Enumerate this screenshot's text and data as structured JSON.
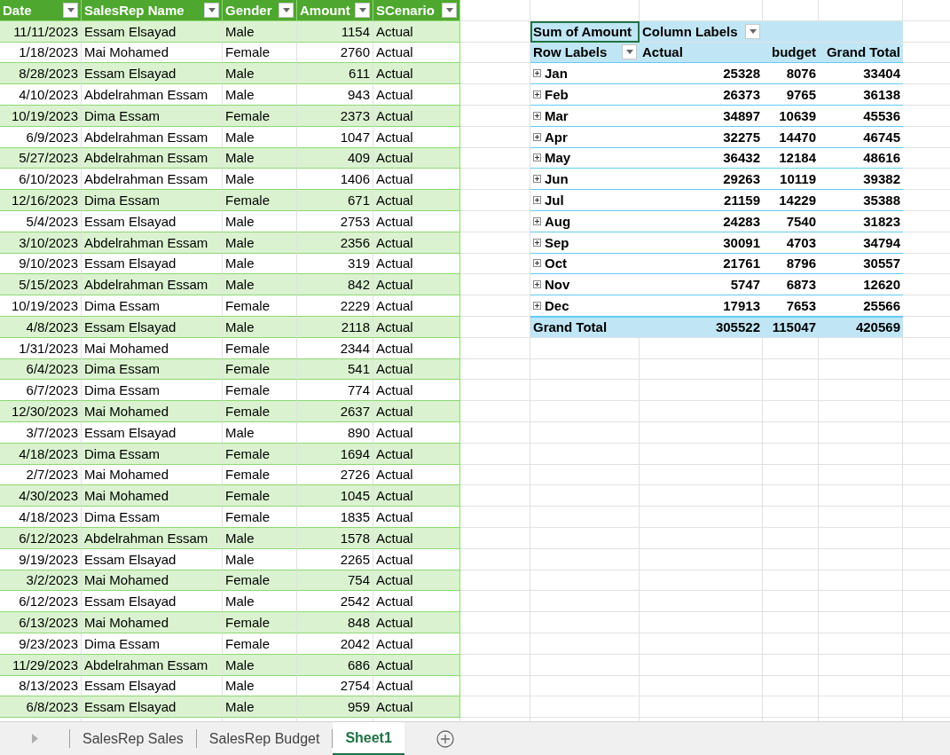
{
  "table": {
    "columns": [
      "Date",
      "SalesRep Name",
      "Gender",
      "Amount",
      "SCenario"
    ],
    "rows": [
      [
        "11/11/2023",
        "Essam Elsayad",
        "Male",
        "1154",
        "Actual"
      ],
      [
        "1/18/2023",
        "Mai Mohamed",
        "Female",
        "2760",
        "Actual"
      ],
      [
        "8/28/2023",
        "Essam Elsayad",
        "Male",
        "611",
        "Actual"
      ],
      [
        "4/10/2023",
        "Abdelrahman Essam",
        "Male",
        "943",
        "Actual"
      ],
      [
        "10/19/2023",
        "Dima Essam",
        "Female",
        "2373",
        "Actual"
      ],
      [
        "6/9/2023",
        "Abdelrahman Essam",
        "Male",
        "1047",
        "Actual"
      ],
      [
        "5/27/2023",
        "Abdelrahman Essam",
        "Male",
        "409",
        "Actual"
      ],
      [
        "6/10/2023",
        "Abdelrahman Essam",
        "Male",
        "1406",
        "Actual"
      ],
      [
        "12/16/2023",
        "Dima Essam",
        "Female",
        "671",
        "Actual"
      ],
      [
        "5/4/2023",
        "Essam Elsayad",
        "Male",
        "2753",
        "Actual"
      ],
      [
        "3/10/2023",
        "Abdelrahman Essam",
        "Male",
        "2356",
        "Actual"
      ],
      [
        "9/10/2023",
        "Essam Elsayad",
        "Male",
        "319",
        "Actual"
      ],
      [
        "5/15/2023",
        "Abdelrahman Essam",
        "Male",
        "842",
        "Actual"
      ],
      [
        "10/19/2023",
        "Dima Essam",
        "Female",
        "2229",
        "Actual"
      ],
      [
        "4/8/2023",
        "Essam Elsayad",
        "Male",
        "2118",
        "Actual"
      ],
      [
        "1/31/2023",
        "Mai Mohamed",
        "Female",
        "2344",
        "Actual"
      ],
      [
        "6/4/2023",
        "Dima Essam",
        "Female",
        "541",
        "Actual"
      ],
      [
        "6/7/2023",
        "Dima Essam",
        "Female",
        "774",
        "Actual"
      ],
      [
        "12/30/2023",
        "Mai Mohamed",
        "Female",
        "2637",
        "Actual"
      ],
      [
        "3/7/2023",
        "Essam Elsayad",
        "Male",
        "890",
        "Actual"
      ],
      [
        "4/18/2023",
        "Dima Essam",
        "Female",
        "1694",
        "Actual"
      ],
      [
        "2/7/2023",
        "Mai Mohamed",
        "Female",
        "2726",
        "Actual"
      ],
      [
        "4/30/2023",
        "Mai Mohamed",
        "Female",
        "1045",
        "Actual"
      ],
      [
        "4/18/2023",
        "Dima Essam",
        "Female",
        "1835",
        "Actual"
      ],
      [
        "6/12/2023",
        "Abdelrahman Essam",
        "Male",
        "1578",
        "Actual"
      ],
      [
        "9/19/2023",
        "Essam Elsayad",
        "Male",
        "2265",
        "Actual"
      ],
      [
        "3/2/2023",
        "Mai Mohamed",
        "Female",
        "754",
        "Actual"
      ],
      [
        "6/12/2023",
        "Essam Elsayad",
        "Male",
        "2542",
        "Actual"
      ],
      [
        "6/13/2023",
        "Mai Mohamed",
        "Female",
        "848",
        "Actual"
      ],
      [
        "9/23/2023",
        "Dima Essam",
        "Female",
        "2042",
        "Actual"
      ],
      [
        "11/29/2023",
        "Abdelrahman Essam",
        "Male",
        "686",
        "Actual"
      ],
      [
        "8/13/2023",
        "Essam Elsayad",
        "Male",
        "2754",
        "Actual"
      ],
      [
        "6/8/2023",
        "Essam Elsayad",
        "Male",
        "959",
        "Actual"
      ]
    ]
  },
  "pivot": {
    "value_label": {
      "text": "Sum of Amount",
      "selected": true
    },
    "column_labels": "Column Labels",
    "row_labels": "Row Labels",
    "columns": [
      "Actual",
      "budget",
      "Grand Total"
    ],
    "rows": [
      {
        "label": "Jan",
        "values": [
          "25328",
          "8076",
          "33404"
        ]
      },
      {
        "label": "Feb",
        "values": [
          "26373",
          "9765",
          "36138"
        ]
      },
      {
        "label": "Mar",
        "values": [
          "34897",
          "10639",
          "45536"
        ]
      },
      {
        "label": "Apr",
        "values": [
          "32275",
          "14470",
          "46745"
        ]
      },
      {
        "label": "May",
        "values": [
          "36432",
          "12184",
          "48616"
        ]
      },
      {
        "label": "Jun",
        "values": [
          "29263",
          "10119",
          "39382"
        ]
      },
      {
        "label": "Jul",
        "values": [
          "21159",
          "14229",
          "35388"
        ]
      },
      {
        "label": "Aug",
        "values": [
          "24283",
          "7540",
          "31823"
        ]
      },
      {
        "label": "Sep",
        "values": [
          "30091",
          "4703",
          "34794"
        ]
      },
      {
        "label": "Oct",
        "values": [
          "21761",
          "8796",
          "30557"
        ]
      },
      {
        "label": "Nov",
        "values": [
          "5747",
          "6873",
          "12620"
        ]
      },
      {
        "label": "Dec",
        "values": [
          "17913",
          "7653",
          "25566"
        ]
      }
    ],
    "grand_total": {
      "label": "Grand Total",
      "values": [
        "305522",
        "115047",
        "420569"
      ]
    }
  },
  "sheet_tabs": [
    {
      "label": "SalesRep Sales",
      "selected": false
    },
    {
      "label": "SalesRep Budget",
      "selected": false
    },
    {
      "label": "Sheet1",
      "selected": true
    }
  ]
}
